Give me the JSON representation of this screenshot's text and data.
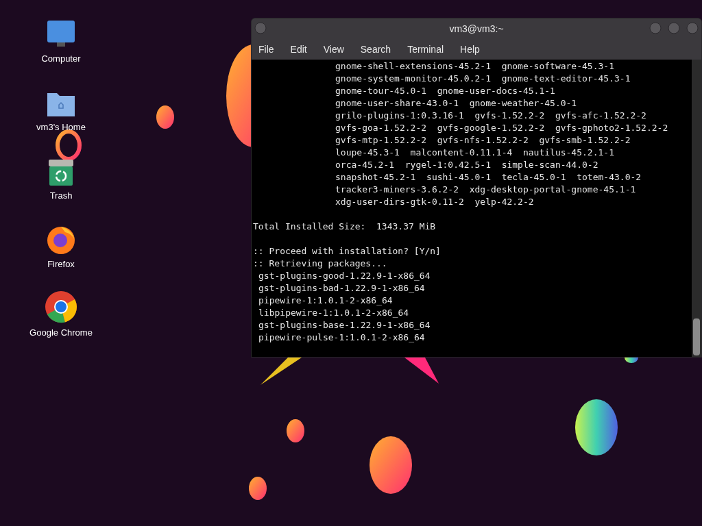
{
  "desktop_icons": [
    {
      "kind": "computer",
      "label": "Computer"
    },
    {
      "kind": "home",
      "label": "vm3's Home"
    },
    {
      "kind": "trash",
      "label": "Trash"
    },
    {
      "kind": "firefox",
      "label": "Firefox"
    },
    {
      "kind": "chrome",
      "label": "Google Chrome"
    }
  ],
  "window": {
    "title": "vm3@vm3:~",
    "menu": [
      "File",
      "Edit",
      "View",
      "Search",
      "Terminal",
      "Help"
    ]
  },
  "terminal_lines": [
    {
      "kind": "continuation",
      "text": "gnome-shell-extensions-45.2-1  gnome-software-45.3-1"
    },
    {
      "kind": "continuation",
      "text": "gnome-system-monitor-45.0.2-1  gnome-text-editor-45.3-1"
    },
    {
      "kind": "continuation",
      "text": "gnome-tour-45.0-1  gnome-user-docs-45.1-1"
    },
    {
      "kind": "continuation",
      "text": "gnome-user-share-43.0-1  gnome-weather-45.0-1"
    },
    {
      "kind": "continuation",
      "text": "grilo-plugins-1:0.3.16-1  gvfs-1.52.2-2  gvfs-afc-1.52.2-2"
    },
    {
      "kind": "continuation",
      "text": "gvfs-goa-1.52.2-2  gvfs-google-1.52.2-2  gvfs-gphoto2-1.52.2-2"
    },
    {
      "kind": "continuation",
      "text": "gvfs-mtp-1.52.2-2  gvfs-nfs-1.52.2-2  gvfs-smb-1.52.2-2"
    },
    {
      "kind": "continuation",
      "text": "loupe-45.3-1  malcontent-0.11.1-4  nautilus-45.2.1-1"
    },
    {
      "kind": "continuation",
      "text": "orca-45.2-1  rygel-1:0.42.5-1  simple-scan-44.0-2"
    },
    {
      "kind": "continuation",
      "text": "snapshot-45.2-1  sushi-45.0-1  tecla-45.0-1  totem-43.0-2"
    },
    {
      "kind": "continuation",
      "text": "tracker3-miners-3.6.2-2  xdg-desktop-portal-gnome-45.1-1"
    },
    {
      "kind": "continuation",
      "text": "xdg-user-dirs-gtk-0.11-2  yelp-42.2-2"
    },
    {
      "kind": "section",
      "text": "Total Installed Size:  1343.37 MiB"
    },
    {
      "kind": "section",
      "text": ":: Proceed with installation? [Y/n]"
    },
    {
      "kind": "plain",
      "text": ":: Retrieving packages..."
    },
    {
      "kind": "package",
      "text": "gst-plugins-good-1.22.9-1-x86_64"
    },
    {
      "kind": "package",
      "text": "gst-plugins-bad-1.22.9-1-x86_64"
    },
    {
      "kind": "package",
      "text": "pipewire-1:1.0.1-2-x86_64"
    },
    {
      "kind": "package",
      "text": "libpipewire-1:1.0.1-2-x86_64"
    },
    {
      "kind": "package",
      "text": "gst-plugins-base-1.22.9-1-x86_64"
    },
    {
      "kind": "package",
      "text": "pipewire-pulse-1:1.0.1-2-x86_64"
    }
  ]
}
